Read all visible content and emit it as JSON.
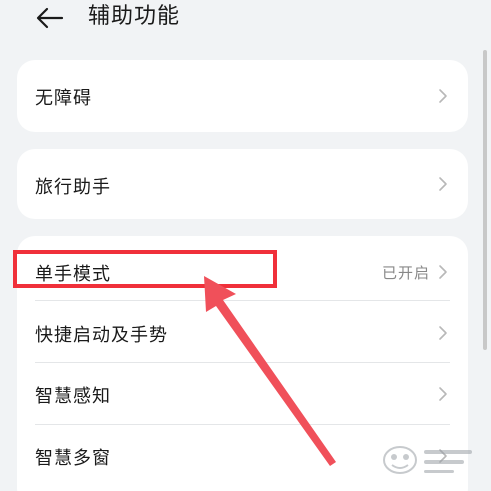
{
  "header": {
    "title": "辅助功能"
  },
  "cards": [
    {
      "items": [
        {
          "label": "无障碍"
        }
      ]
    },
    {
      "items": [
        {
          "label": "旅行助手"
        }
      ]
    },
    {
      "items": [
        {
          "label": "单手模式",
          "status": "已开启"
        },
        {
          "label": "快捷启动及手势"
        },
        {
          "label": "智慧感知"
        },
        {
          "label": "智慧多窗"
        }
      ]
    }
  ],
  "colors": {
    "highlight": "#f0303a",
    "arrow": "#f0505a",
    "background": "#f1f3f5"
  },
  "icons": {
    "back": "back-arrow-icon",
    "chevron": "chevron-right-icon"
  }
}
